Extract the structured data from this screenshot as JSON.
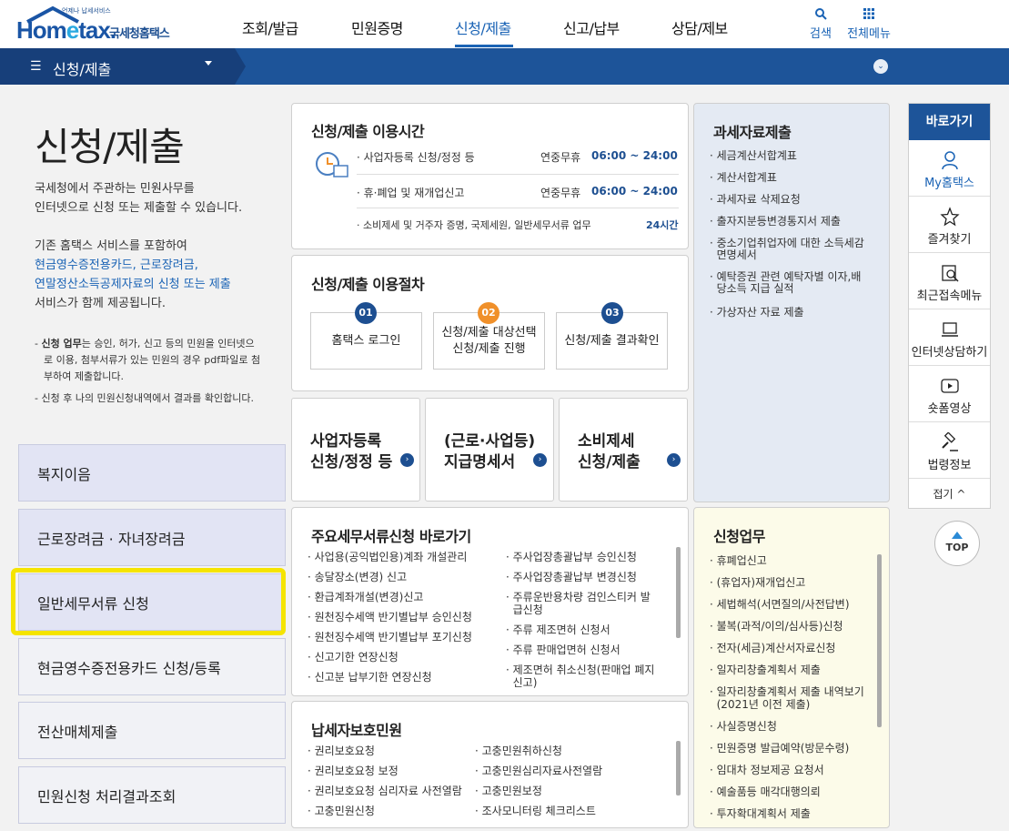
{
  "header": {
    "logo_brand_a": "Hom",
    "logo_brand_e": "e",
    "logo_brand_b": "tax.",
    "logo_sub": "국세청홈택스",
    "logo_tiny": "언제나 납세서비스",
    "menu": [
      "조회/발급",
      "민원증명",
      "신청/제출",
      "신고/납부",
      "상담/제보"
    ],
    "search_label": "검색",
    "allmenu_label": "전체메뉴"
  },
  "navbar": {
    "breadcrumb": "신청/제출",
    "hamburger": "☰"
  },
  "left": {
    "title": "신청/제출",
    "desc1": "국세청에서 주관하는 민원사무를",
    "desc2": "인터넷으로 신청 또는 제출할 수 있습니다.",
    "desc3": "기존 홈택스 서비스를 포함하여",
    "desc4": "현금영수증전용카드, 근로장려금,",
    "desc5": "연말정산소득공제자료의 신청 또는 제출",
    "desc6": "서비스가 함께 제공됩니다.",
    "note1_bold": "신청 업무",
    "note1_rest": "는 승인, 허가, 신고 등의 민원을 인터넷으",
    "note1_l2": "로 이용, 첨부서류가 있는 민원의 경우 pdf파일로 첨",
    "note1_l3": "부하여 제출합니다.",
    "note2": "- 신청 후 나의 민원신청내역에서 결과를 확인합니다.",
    "buttons": [
      "복지이음",
      "근로장려금 · 자녀장려금",
      "일반세무서류 신청",
      "현금영수증전용카드 신청/등록",
      "전산매체제출",
      "민원신청 처리결과조회"
    ]
  },
  "hours": {
    "title": "신청/제출 이용시간",
    "rows": [
      {
        "label": "· 사업자등록 신청/정정 등",
        "days": "연중무휴",
        "time": "06:00 ~ 24:00"
      },
      {
        "label": "· 휴·폐업 및 재개업신고",
        "days": "연중무휴",
        "time": "06:00 ~ 24:00"
      },
      {
        "label": "· 소비제세 및 거주자 증명, 국제세원, 일반세무서류 업무",
        "days": "",
        "time": "24시간"
      }
    ]
  },
  "procedure": {
    "title": "신청/제출 이용절차",
    "steps": [
      {
        "num": "01",
        "l1": "홈택스 로그인",
        "l2": ""
      },
      {
        "num": "02",
        "l1": "신청/제출 대상선택",
        "l2": "신청/제출 진행"
      },
      {
        "num": "03",
        "l1": "신청/제출 결과확인",
        "l2": ""
      }
    ]
  },
  "cards": [
    {
      "l1": "사업자등록",
      "l2": "신청/정정 등"
    },
    {
      "l1": "(근로·사업등)",
      "l2": "지급명세서"
    },
    {
      "l1": "소비제세",
      "l2": "신청/제출"
    }
  ],
  "submit": {
    "title": "과세자료제출",
    "items": [
      "· 세금계산서합계표",
      "· 계산서합계표",
      "· 과세자료 삭제요청",
      "· 출자지분등변경통지서 제출",
      "· 중소기업취업자에 대한 소득세감",
      "  면명세서",
      "· 예탁증권 관련 예탁자별 이자,배",
      "  당소득 지급 실적",
      "· 가상자산 자료 제출"
    ]
  },
  "shortcuts": {
    "title": "주요세무서류신청 바로가기",
    "col1": [
      "· 사업용(공익법인용)계좌 개설관리",
      "· 송달장소(변경) 신고",
      "· 환급계좌개설(변경)신고",
      "· 원천징수세액 반기별납부 승인신청",
      "· 원천징수세액 반기별납부 포기신청",
      "· 신고기한 연장신청",
      "· 신고분 납부기한 연장신청"
    ],
    "col2": [
      "· 주사업장총괄납부 승인신청",
      "· 주사업장총괄납부 변경신청",
      "· 주류운반용차량 검인스티커 발",
      "  급신청",
      "· 주류 제조면허 신청서",
      "· 주류 판매업면허 신청서",
      "· 제조면허 취소신청(판매업 폐지",
      "  신고)"
    ]
  },
  "protect": {
    "title": "납세자보호민원",
    "col1": [
      "· 권리보호요청",
      "· 권리보호요청 보정",
      "· 권리보호요청 심리자료 사전열람",
      "· 고충민원신청"
    ],
    "col2": [
      "· 고충민원취하신청",
      "· 고충민원심리자료사전열람",
      "· 고충민원보정",
      "· 조사모니터링 체크리스트"
    ]
  },
  "apply": {
    "title": "신청업무",
    "items": [
      "· 휴폐업신고",
      "· (휴업자)재개업신고",
      "· 세법해석(서면질의/사전답변)",
      "· 불복(과적/이의/심사등)신청",
      "· 전자(세금)계산서자료신청",
      "· 일자리창출계획서 제출",
      "· 일자리창출계획서 제출 내역보기",
      "  (2021년 이전 제출)",
      "· 사실증명신청",
      "· 민원증명 발급예약(방문수령)",
      "· 임대차 정보제공 요청서",
      "· 예술품등 매각대행의뢰",
      "· 투자확대계획서 제출"
    ]
  },
  "quick": {
    "title": "바로가기",
    "items": [
      "My홈택스",
      "즐겨찾기",
      "최근접속메뉴",
      "인터넷상담하기",
      "숏폼영상",
      "법령정보"
    ],
    "collapse": "접기 ^",
    "top": "TOP"
  },
  "colors": {
    "primary": "#1d5499",
    "accent_orange": "#f0902a",
    "highlight": "#f5e400"
  }
}
